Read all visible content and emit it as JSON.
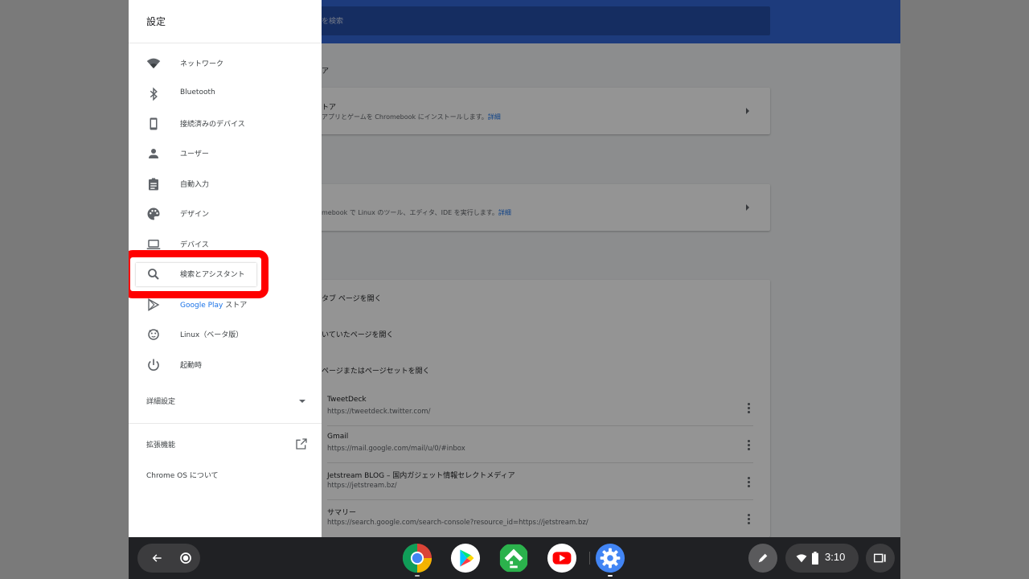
{
  "background_page": {
    "search_placeholder": "を検索",
    "section_store_heading": "ア",
    "store_card": {
      "title": "トア",
      "description": "アプリとゲームを Chromebook にインストールします。",
      "link": "詳細"
    },
    "linux_card": {
      "description": "mebook で Linux のツール、エディタ、IDE を実行します。",
      "link": "詳細"
    },
    "startup_options": [
      "タブ ページを開く",
      "いていたページを開く",
      "ページまたはページセットを開く"
    ],
    "startup_pages": [
      {
        "title": "TweetDeck",
        "url": "https://tweetdeck.twitter.com/"
      },
      {
        "title": "Gmail",
        "url": "https://mail.google.com/mail/u/0/#inbox"
      },
      {
        "title": "Jetstream BLOG – 国内ガジェット情報セレクトメディア",
        "url": "https://jetstream.bz/"
      },
      {
        "title": "サマリー",
        "url": "https://search.google.com/search-console?resource_id=https://jetstream.bz/"
      }
    ]
  },
  "drawer": {
    "title": "設定",
    "items": [
      {
        "label": "ネットワーク",
        "icon": "wifi-icon"
      },
      {
        "label": "Bluetooth",
        "icon": "bluetooth-icon"
      },
      {
        "label": "接続済みのデバイス",
        "icon": "phone-icon"
      },
      {
        "label": "ユーザー",
        "icon": "person-icon"
      },
      {
        "label": "自動入力",
        "icon": "clipboard-icon"
      },
      {
        "label": "デザイン",
        "icon": "palette-icon"
      },
      {
        "label": "デバイス",
        "icon": "laptop-icon"
      },
      {
        "label": "検索とアシスタント",
        "icon": "search-icon",
        "selected": true
      },
      {
        "label_brand": "Google Play",
        "label_rest": " ストア",
        "icon": "play-store-icon"
      },
      {
        "label": "Linux（ベータ版）",
        "icon": "linux-penguin-icon"
      },
      {
        "label": "起動時",
        "icon": "power-icon"
      }
    ],
    "advanced_label": "詳細設定",
    "extensions_label": "拡張機能",
    "about_label": "Chrome OS について"
  },
  "shelf": {
    "apps": [
      "chrome-icon",
      "play-store-icon",
      "feedly-icon",
      "youtube-icon",
      "settings-icon"
    ],
    "clock": "3:10"
  },
  "colors": {
    "highlight": "#ff0000",
    "topbar": "#3367d6",
    "accent": "#1a73e8"
  }
}
